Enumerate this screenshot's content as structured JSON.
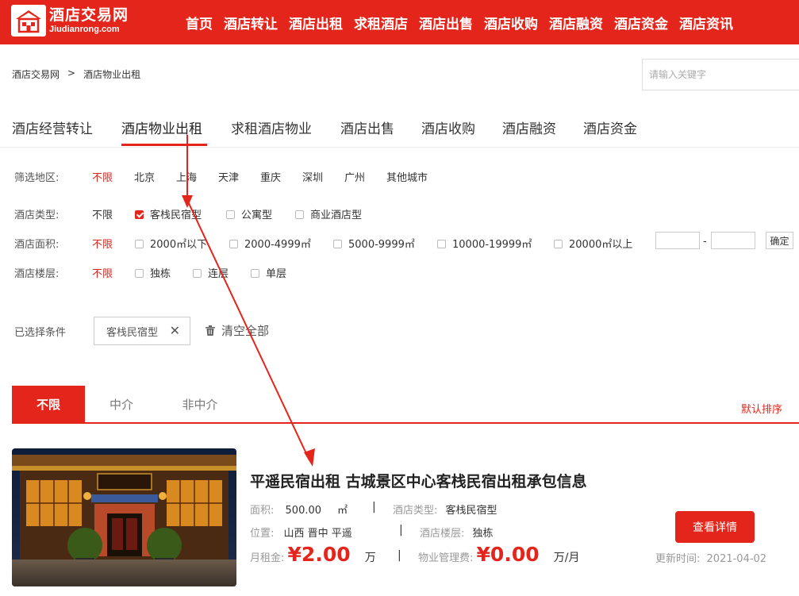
{
  "header": {
    "logo_cn": "酒店交易网",
    "logo_en": "Jiudianrong.com",
    "nav": [
      "首页",
      "酒店转让",
      "酒店出租",
      "求租酒店",
      "酒店出售",
      "酒店收购",
      "酒店融资",
      "酒店资金",
      "酒店资讯"
    ],
    "brand_color": "#e4251b"
  },
  "breadcrumb": {
    "home": "酒店交易网",
    "separator": ">",
    "current": "酒店物业出租"
  },
  "search": {
    "placeholder": "请输入关键字"
  },
  "category_tabs": {
    "items": [
      "酒店经营转让",
      "酒店物业出租",
      "求租酒店物业",
      "酒店出售",
      "酒店收购",
      "酒店融资",
      "酒店资金"
    ],
    "active": "酒店物业出租"
  },
  "filters": {
    "region": {
      "label": "筛选地区:",
      "options": [
        "不限",
        "北京",
        "上海",
        "天津",
        "重庆",
        "深圳",
        "广州",
        "其他城市"
      ],
      "selected": "不限"
    },
    "type": {
      "label": "酒店类型:",
      "all": "不限",
      "options": [
        "客栈民宿型",
        "公寓型",
        "商业酒店型"
      ],
      "checked": "客栈民宿型"
    },
    "area": {
      "label": "酒店面积:",
      "all": "不限",
      "options": [
        "2000㎡以下",
        "2000-4999㎡",
        "5000-9999㎡",
        "10000-19999㎡",
        "20000㎡以上"
      ],
      "range_dash": "-",
      "confirm": "确定"
    },
    "floor": {
      "label": "酒店楼层:",
      "all": "不限",
      "options": [
        "独栋",
        "连层",
        "单层"
      ]
    }
  },
  "selected": {
    "label": "已选择条件",
    "tag": "客栈民宿型",
    "clear": "清空全部"
  },
  "agent_tabs": {
    "items": [
      "不限",
      "中介",
      "非中介"
    ],
    "active": "不限",
    "sort": "默认排序"
  },
  "listing": {
    "title": "平遥民宿出租 古城景区中心客栈民宿出租承包信息",
    "area_label": "面积:",
    "area_value": "500.00",
    "area_unit": "㎡",
    "type_label": "酒店类型:",
    "type_value": "客栈民宿型",
    "location_label": "位置:",
    "location_value": "山西 晋中 平遥",
    "floor_label": "酒店楼层:",
    "floor_value": "独栋",
    "rent_label": "月租金:",
    "rent_value": "¥2.00",
    "rent_unit": "万",
    "fee_label": "物业管理费:",
    "fee_value": "¥0.00",
    "fee_unit": "万/月",
    "detail_button": "查看详情",
    "update_label": "更新时间:",
    "update_value": "2021-04-02",
    "divider": "|"
  }
}
